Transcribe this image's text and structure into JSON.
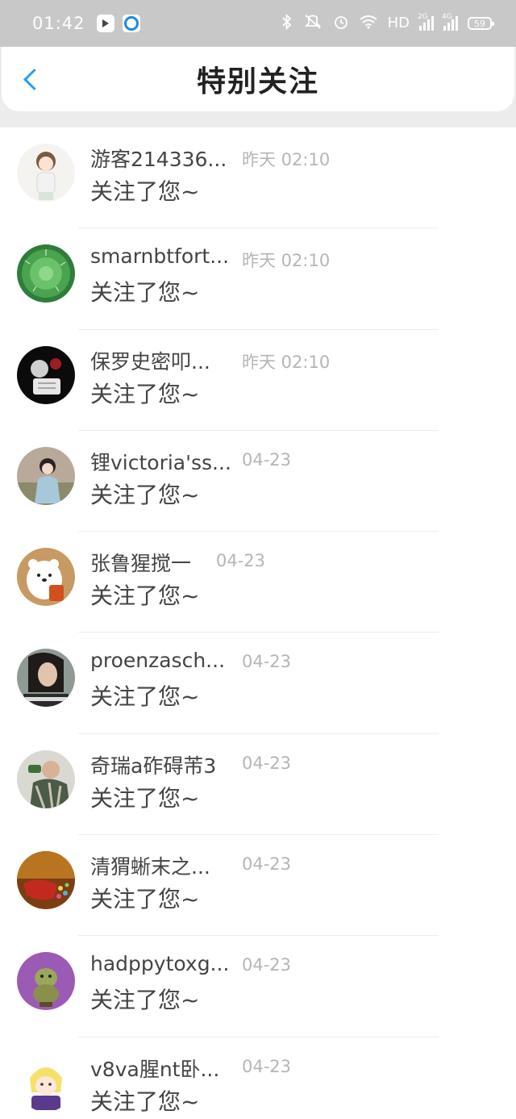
{
  "status_bar": {
    "time": "01:42",
    "network_label": "HD",
    "signal_1_label": "2G",
    "signal_2_label": "4G",
    "battery": "59"
  },
  "header": {
    "title": "特别关注"
  },
  "items": [
    {
      "name": "游客214336...",
      "time": "昨天 02:10",
      "action": "关注了您~"
    },
    {
      "name": "smarnbtfort...",
      "time": "昨天 02:10",
      "action": "关注了您~"
    },
    {
      "name": "保罗史密叩...",
      "time": "昨天 02:10",
      "action": "关注了您~"
    },
    {
      "name": "锂victoria'ss...",
      "time": "04-23",
      "action": "关注了您~"
    },
    {
      "name": "张鲁猩搅一",
      "time": "04-23",
      "action": "关注了您~"
    },
    {
      "name": "proenzasch...",
      "time": "04-23",
      "action": "关注了您~"
    },
    {
      "name": "奇瑞a砟碍芾3",
      "time": "04-23",
      "action": "关注了您~"
    },
    {
      "name": "清猬蜥末之...",
      "time": "04-23",
      "action": "关注了您~"
    },
    {
      "name": "hadppytoxg...",
      "time": "04-23",
      "action": "关注了您~"
    },
    {
      "name": "v8va腥nt卧...",
      "time": "04-23",
      "action": "关注了您~"
    }
  ],
  "colors": {
    "accent": "#2a9bf5",
    "status_bar": "#c8c8c8",
    "time_text": "#b5b5b5"
  }
}
